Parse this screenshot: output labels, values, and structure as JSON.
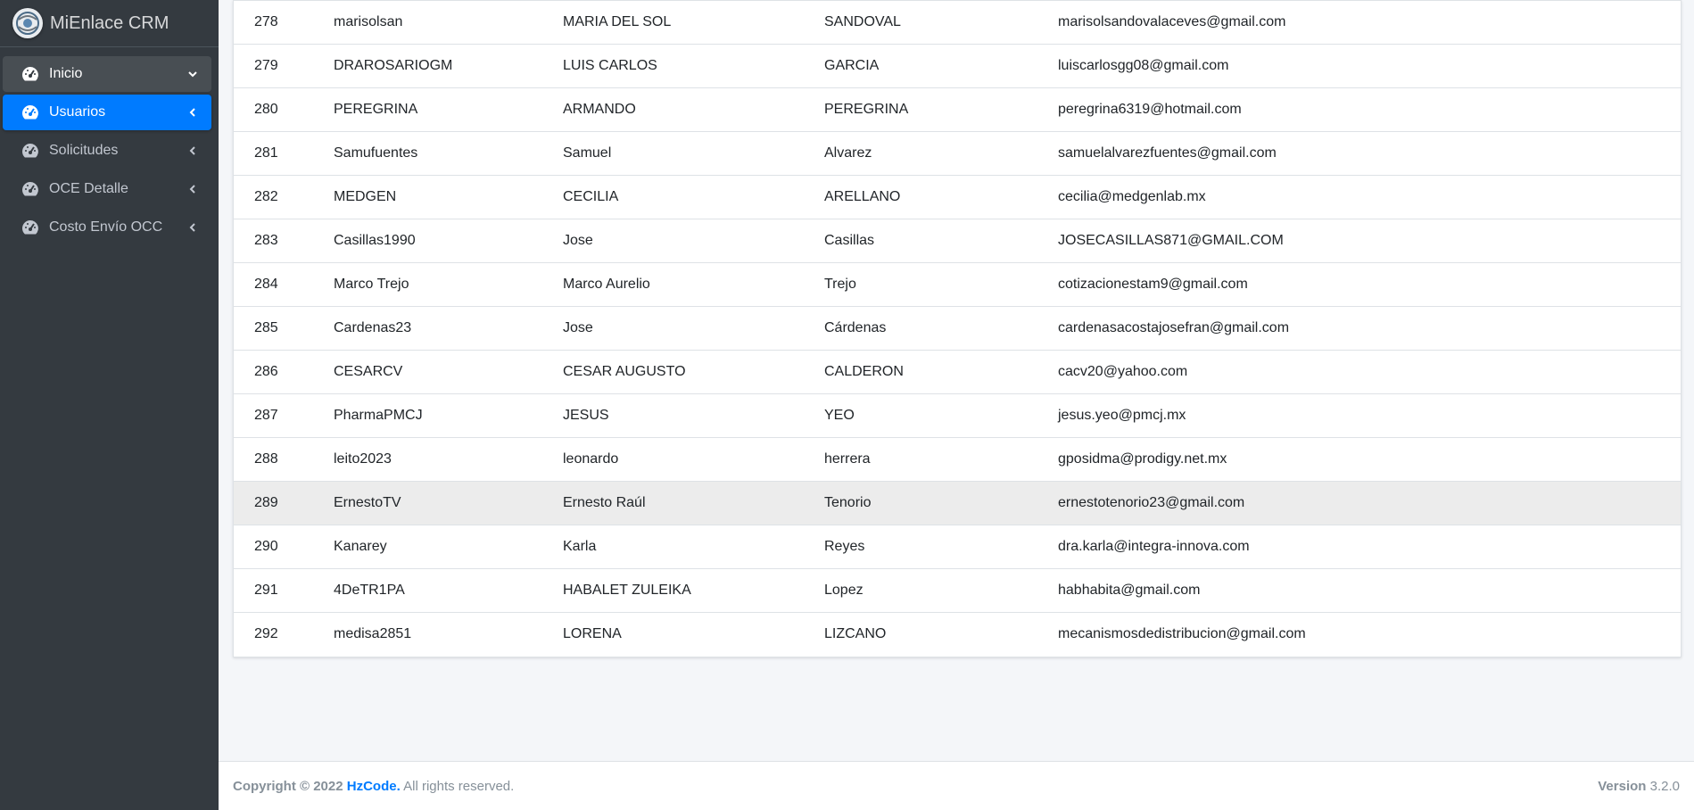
{
  "app": {
    "title": "MiEnlace CRM"
  },
  "sidebar": {
    "items": [
      {
        "label": "Inicio",
        "state": "open",
        "arrow": "chevron-down"
      },
      {
        "label": "Usuarios",
        "state": "active",
        "arrow": "chevron-left"
      },
      {
        "label": "Solicitudes",
        "state": "normal",
        "arrow": "chevron-left"
      },
      {
        "label": "OCE Detalle",
        "state": "normal",
        "arrow": "chevron-left"
      },
      {
        "label": "Costo Envío OCC",
        "state": "normal",
        "arrow": "chevron-left"
      }
    ]
  },
  "table": {
    "rows": [
      {
        "id": "278",
        "username": "marisolsan",
        "name": "MARIA DEL SOL",
        "last_name": "SANDOVAL",
        "email": "marisolsandovalaceves@gmail.com"
      },
      {
        "id": "279",
        "username": "DRAROSARIOGM",
        "name": "LUIS CARLOS",
        "last_name": "GARCIA",
        "email": "luiscarlosgg08@gmail.com"
      },
      {
        "id": "280",
        "username": "PEREGRINA",
        "name": "ARMANDO",
        "last_name": "PEREGRINA",
        "email": "peregrina6319@hotmail.com"
      },
      {
        "id": "281",
        "username": "Samufuentes",
        "name": "Samuel",
        "last_name": "Alvarez",
        "email": "samuelalvarezfuentes@gmail.com"
      },
      {
        "id": "282",
        "username": "MEDGEN",
        "name": "CECILIA",
        "last_name": "ARELLANO",
        "email": "cecilia@medgenlab.mx"
      },
      {
        "id": "283",
        "username": "Casillas1990",
        "name": "Jose",
        "last_name": "Casillas",
        "email": "JOSECASILLAS871@GMAIL.COM"
      },
      {
        "id": "284",
        "username": "Marco Trejo",
        "name": "Marco Aurelio",
        "last_name": "Trejo",
        "email": "cotizacionestam9@gmail.com"
      },
      {
        "id": "285",
        "username": "Cardenas23",
        "name": "Jose",
        "last_name": "Cárdenas",
        "email": "cardenasacostajosefran@gmail.com"
      },
      {
        "id": "286",
        "username": "CESARCV",
        "name": "CESAR AUGUSTO",
        "last_name": "CALDERON",
        "email": "cacv20@yahoo.com"
      },
      {
        "id": "287",
        "username": "PharmaPMCJ",
        "name": "JESUS",
        "last_name": "YEO",
        "email": "jesus.yeo@pmcj.mx"
      },
      {
        "id": "288",
        "username": "leito2023",
        "name": "leonardo",
        "last_name": "herrera",
        "email": "gposidma@prodigy.net.mx"
      },
      {
        "id": "289",
        "username": "ErnestoTV",
        "name": "Ernesto Raúl",
        "last_name": "Tenorio",
        "email": "ernestotenorio23@gmail.com"
      },
      {
        "id": "290",
        "username": "Kanarey",
        "name": "Karla",
        "last_name": "Reyes",
        "email": "dra.karla@integra-innova.com"
      },
      {
        "id": "291",
        "username": "4DeTR1PA",
        "name": "HABALET ZULEIKA",
        "last_name": "Lopez",
        "email": "habhabita@gmail.com"
      },
      {
        "id": "292",
        "username": "medisa2851",
        "name": "LORENA",
        "last_name": "LIZCANO",
        "email": "mecanismosdedistribucion@gmail.com"
      }
    ],
    "hovered_id": "289"
  },
  "footer": {
    "copyright": "Copyright © 2022",
    "company": "HzCode.",
    "rights": "All rights reserved.",
    "version_label": "Version",
    "version": "3.2.0"
  },
  "colors": {
    "sidebar_bg": "#343a40",
    "active": "#007bff",
    "link": "#007bff"
  }
}
